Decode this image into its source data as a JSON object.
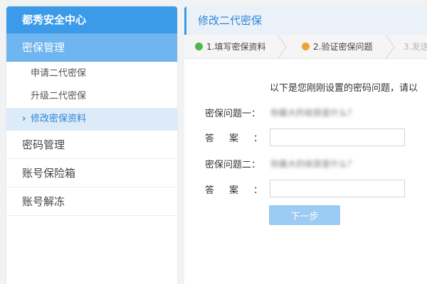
{
  "sidebar": {
    "title": "都秀安全中心",
    "group": "密保管理",
    "sub_items": [
      {
        "label": "申请二代密保"
      },
      {
        "label": "升级二代密保"
      },
      {
        "label": "修改密保资料"
      }
    ],
    "items": [
      {
        "label": "密码管理"
      },
      {
        "label": "账号保险箱"
      },
      {
        "label": "账号解冻"
      }
    ]
  },
  "main": {
    "title": "修改二代密保",
    "steps": [
      {
        "label": "1.填写密保资料",
        "status": "done"
      },
      {
        "label": "2.验证密保问题",
        "status": "current"
      },
      {
        "label": "3.发送"
      }
    ],
    "intro": "以下是您刚刚设置的密码问题，请以",
    "question1_label": "密保问题一：",
    "question1_text": "你最大的收获是什么？",
    "answer_label": "答案：",
    "answer1_value": "",
    "question2_label": "密保问题二：",
    "question2_text": "你最大的收获是什么？",
    "answer2_value": "",
    "next_button": "下一步"
  },
  "colors": {
    "brand": "#3c9be8",
    "group_bg": "#6fb5ef",
    "active_bg": "#ddeaf7",
    "step_done": "#4cb84c",
    "step_current": "#f0a237",
    "button": "#9ccbf3"
  },
  "icons": {
    "step_done": "check-circle-icon",
    "step_current": "dots-circle-icon",
    "active_marker": "chevron-right-icon"
  }
}
